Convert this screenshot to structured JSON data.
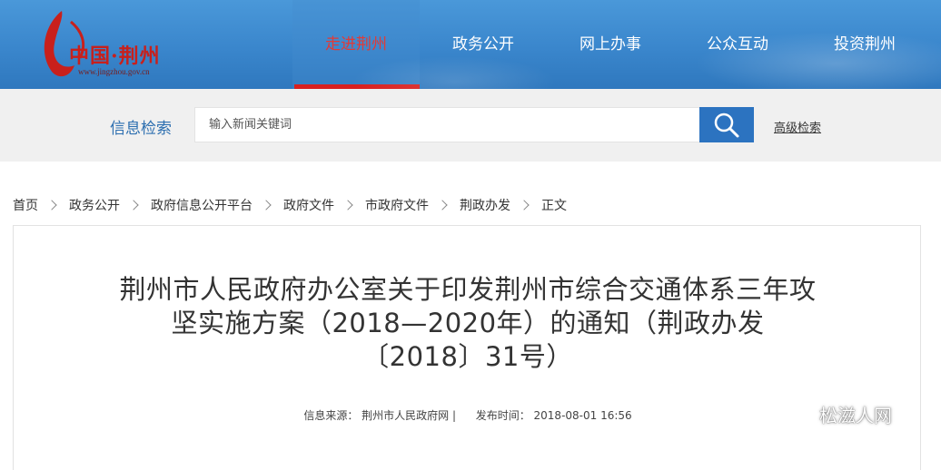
{
  "header": {
    "logo_text": "中国·荆州",
    "logo_url": "www.jingzhou.gov.cn",
    "nav": [
      {
        "label": "走进荆州",
        "active": true
      },
      {
        "label": "政务公开"
      },
      {
        "label": "网上办事"
      },
      {
        "label": "公众互动"
      },
      {
        "label": "投资荆州"
      }
    ]
  },
  "search": {
    "title": "信息检索",
    "placeholder": "输入新闻关键词",
    "advanced_label": "高级检索"
  },
  "breadcrumb": [
    "首页",
    "政务公开",
    "政府信息公开平台",
    "政府文件",
    "市政府文件",
    "荆政办发",
    "正文"
  ],
  "article": {
    "title_lines": [
      "荆州市人民政府办公室关于印发荆州市综合交通体系三年攻",
      "坚实施方案（2018—2020年）的通知（荆政办发",
      "〔2018〕31号）"
    ],
    "source_label": "信息来源：",
    "source_value": "荆州市人民政府网 |",
    "publish_label": "发布时间：",
    "publish_value": "2018-08-01 16:56"
  },
  "watermark": {
    "text": "松滋人网",
    "icon": "wechat-icon"
  },
  "colors": {
    "header_blue": "#3a86cc",
    "accent_red": "#d8201f",
    "search_blue": "#2c73c0"
  }
}
